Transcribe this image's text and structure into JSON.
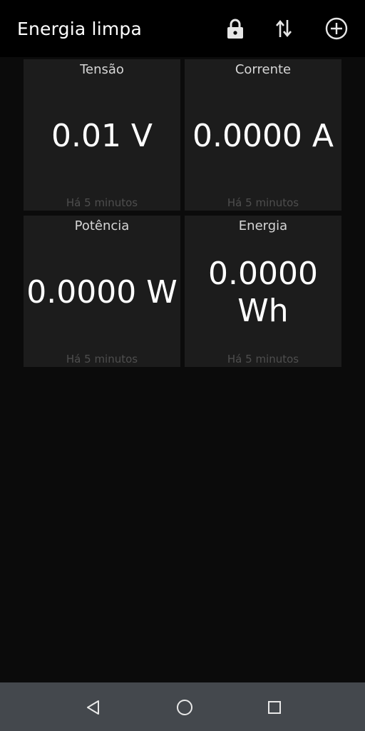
{
  "app_bar": {
    "title": "Energia limpa",
    "actions": [
      {
        "icon": "lock-icon"
      },
      {
        "icon": "swap-vertical-icon"
      },
      {
        "icon": "add-circle-icon"
      }
    ]
  },
  "tiles": [
    {
      "title": "Tensão",
      "value": "0.01 V",
      "time": "Há 5 minutos"
    },
    {
      "title": "Corrente",
      "value": "0.0000 A",
      "time": "Há 5 minutos"
    },
    {
      "title": "Potência",
      "value": "0.0000 W",
      "time": "Há 5 minutos"
    },
    {
      "title": "Energia",
      "value": "0.0000 Wh",
      "time": "Há 5 minutos"
    }
  ],
  "nav_bar": {
    "buttons": [
      "back-icon",
      "home-icon",
      "recents-icon"
    ]
  },
  "colors": {
    "background": "#0b0b0b",
    "app_bar": "#000000",
    "tile": "#1c1c1c",
    "nav_bar": "#44484d"
  }
}
